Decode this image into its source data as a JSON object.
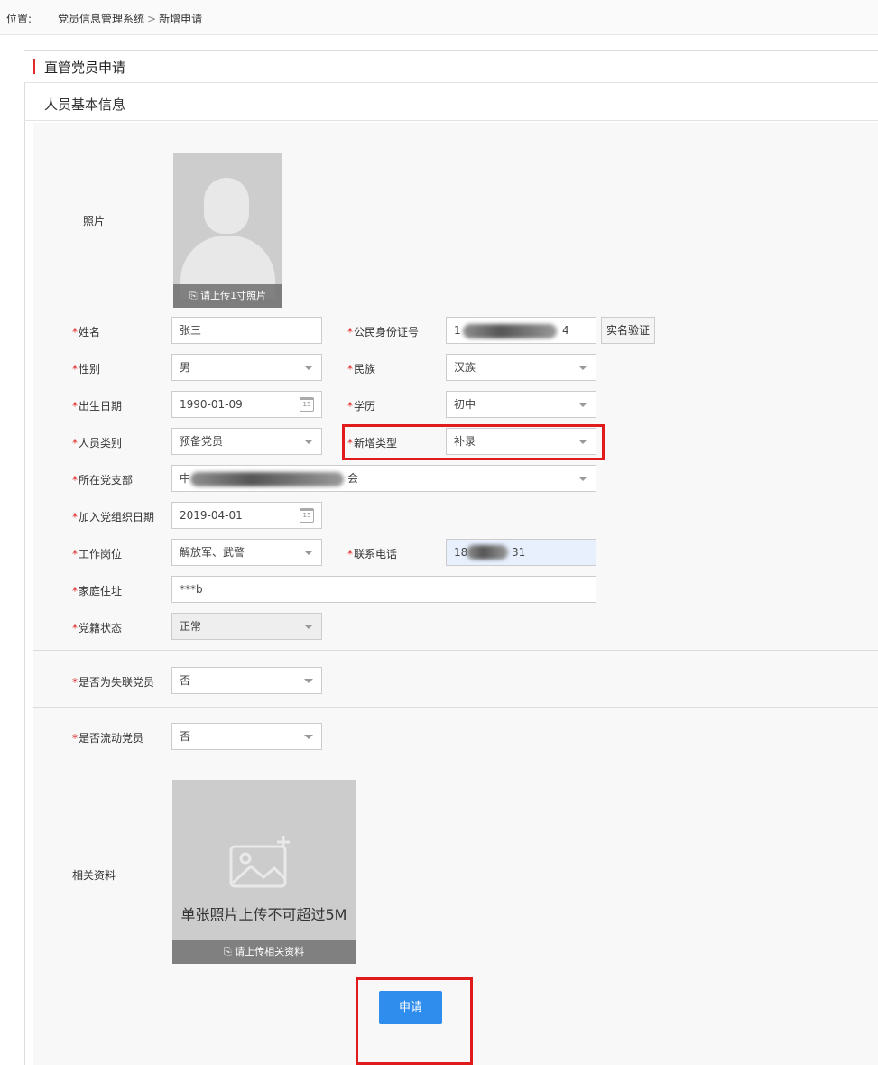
{
  "breadcrumb": {
    "label": "位置:",
    "path": "党员信息管理系统",
    "separator": ">",
    "current": "新增申请"
  },
  "page_title": "直管党员申请",
  "section_title": "人员基本信息",
  "photo": {
    "label": "照片",
    "upload_text": "请上传1寸照片"
  },
  "fields": {
    "name": {
      "label": "姓名",
      "value": "张三"
    },
    "id_number": {
      "label": "公民身份证号",
      "value_start": "1",
      "value_end": "4",
      "verify_button": "实名验证"
    },
    "gender": {
      "label": "性别",
      "value": "男"
    },
    "ethnicity": {
      "label": "民族",
      "value": "汉族"
    },
    "birth_date": {
      "label": "出生日期",
      "value": "1990-01-09"
    },
    "education": {
      "label": "学历",
      "value": "初中"
    },
    "member_type": {
      "label": "人员类别",
      "value": "预备党员"
    },
    "add_type": {
      "label": "新增类型",
      "value": "补录"
    },
    "branch": {
      "label": "所在党支部",
      "value_start": "中",
      "value_end": "会"
    },
    "join_date": {
      "label": "加入党组织日期",
      "value": "2019-04-01"
    },
    "position": {
      "label": "工作岗位",
      "value": "解放军、武警"
    },
    "phone": {
      "label": "联系电话",
      "value_start": "18",
      "value_end": "31"
    },
    "address": {
      "label": "家庭住址",
      "value": "***b"
    },
    "status": {
      "label": "党籍状态",
      "value": "正常"
    },
    "lost_contact": {
      "label": "是否为失联党员",
      "value": "否"
    },
    "mobile_member": {
      "label": "是否流动党员",
      "value": "否"
    }
  },
  "attachments": {
    "label": "相关资料",
    "note": "单张照片上传不可超过5M",
    "upload_text": "请上传相关资料"
  },
  "submit_label": "申请",
  "calendar_day": "15",
  "colors": {
    "required_star": "#e02020",
    "accent_red": "#e01b1b",
    "primary_button": "#2e8ded"
  }
}
